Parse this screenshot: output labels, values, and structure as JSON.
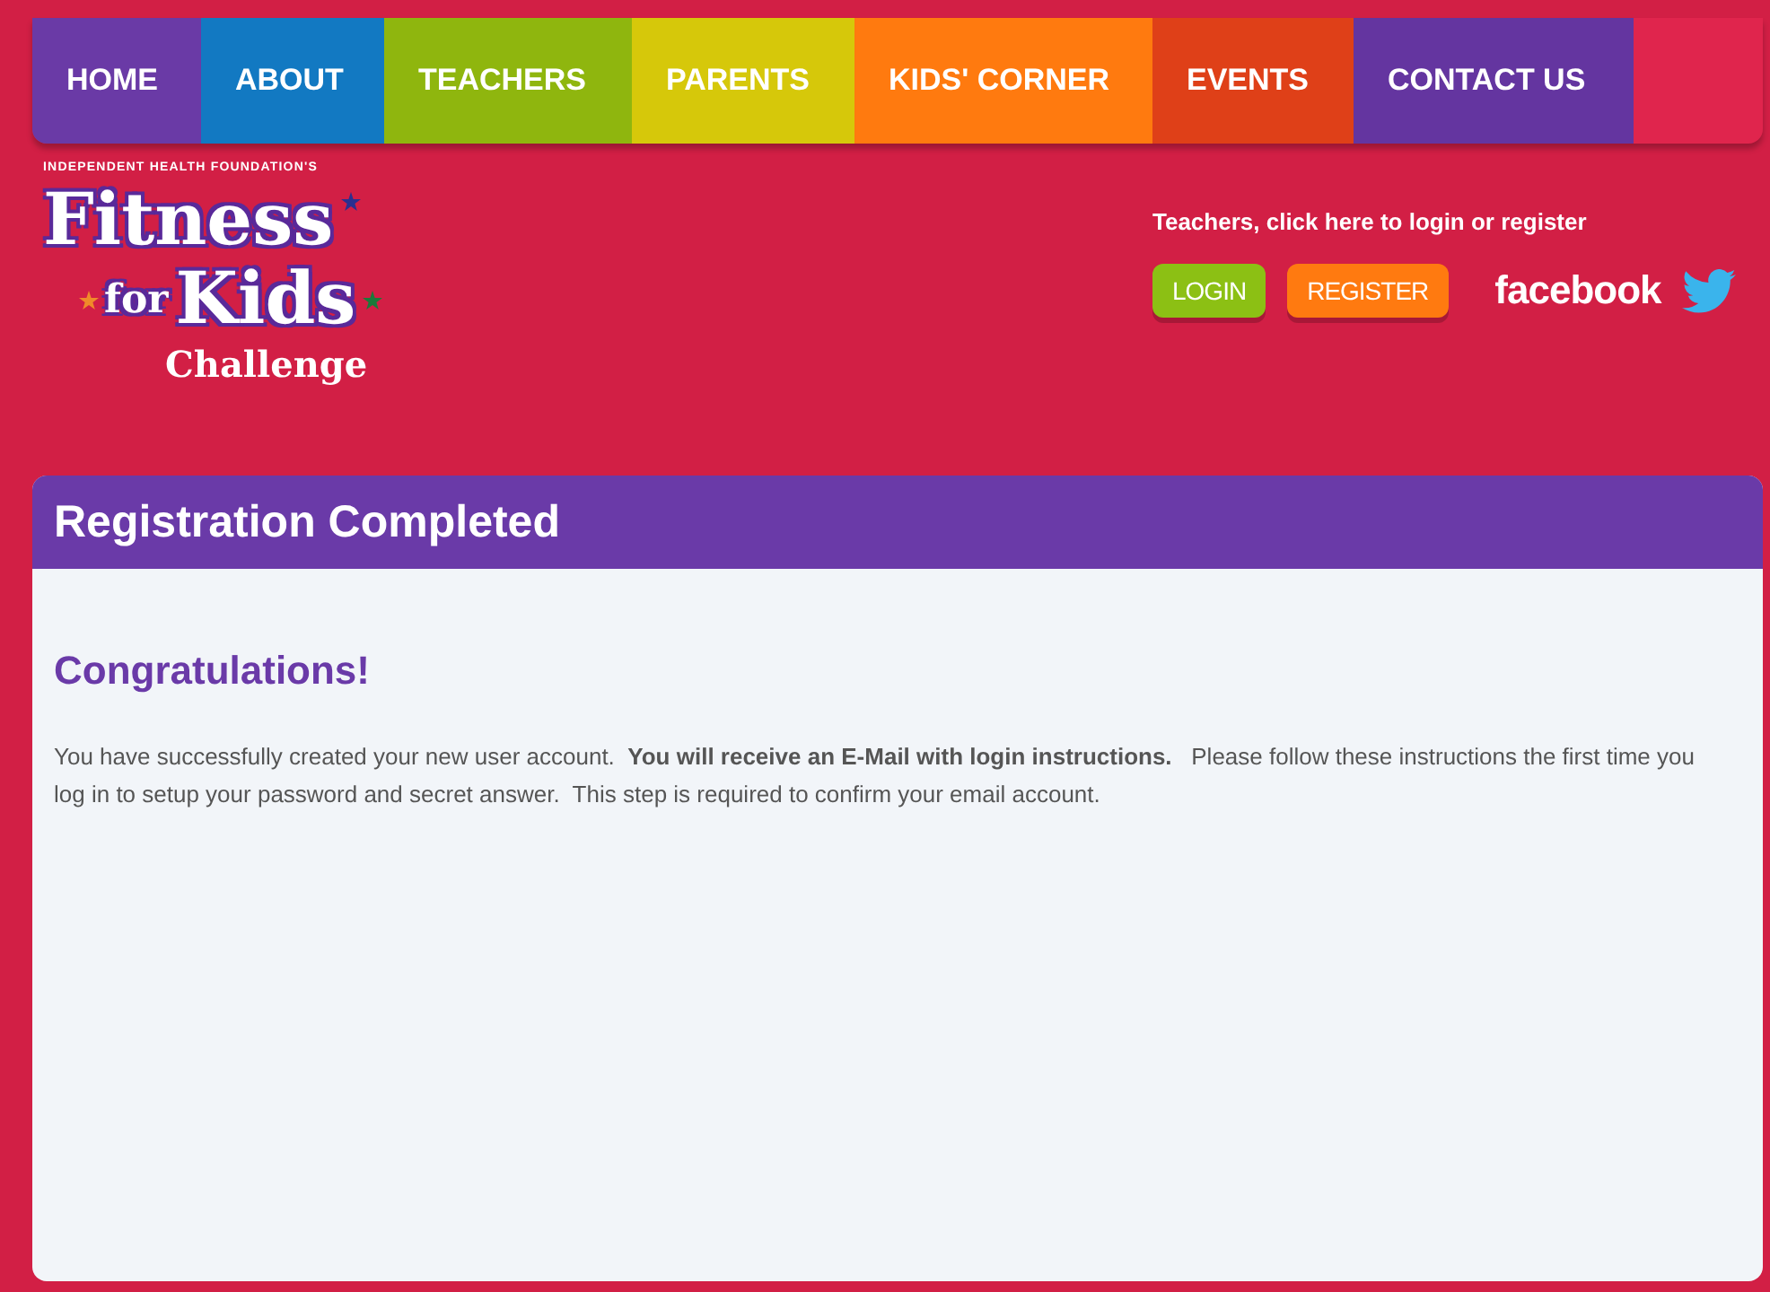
{
  "nav": [
    {
      "label": "HOME",
      "color": "#6a3aa6"
    },
    {
      "label": "ABOUT",
      "color": "#1279c2"
    },
    {
      "label": "TEACHERS",
      "color": "#8fb60e"
    },
    {
      "label": "PARENTS",
      "color": "#d6c80a"
    },
    {
      "label": "KIDS' CORNER",
      "color": "#ff7a0f"
    },
    {
      "label": "EVENTS",
      "color": "#df4018"
    },
    {
      "label": "CONTACT US",
      "color": "#6435a0"
    }
  ],
  "logo": {
    "tagline": "INDEPENDENT HEALTH FOUNDATION'S",
    "line1": "Fitness",
    "line2a": "for",
    "line2b": "Kids",
    "line3": "Challenge"
  },
  "account": {
    "prompt": "Teachers, click here to login or register",
    "login": "LOGIN",
    "register": "REGISTER",
    "social": "facebook"
  },
  "panel": {
    "title": "Registration Completed",
    "heading": "Congratulations!",
    "message": "You have successfully created your new user account.  **You will receive an E-Mail with login instructions.**   Please follow these instructions the first time you log in to setup your password and secret answer.  This step is required to confirm your email account."
  }
}
